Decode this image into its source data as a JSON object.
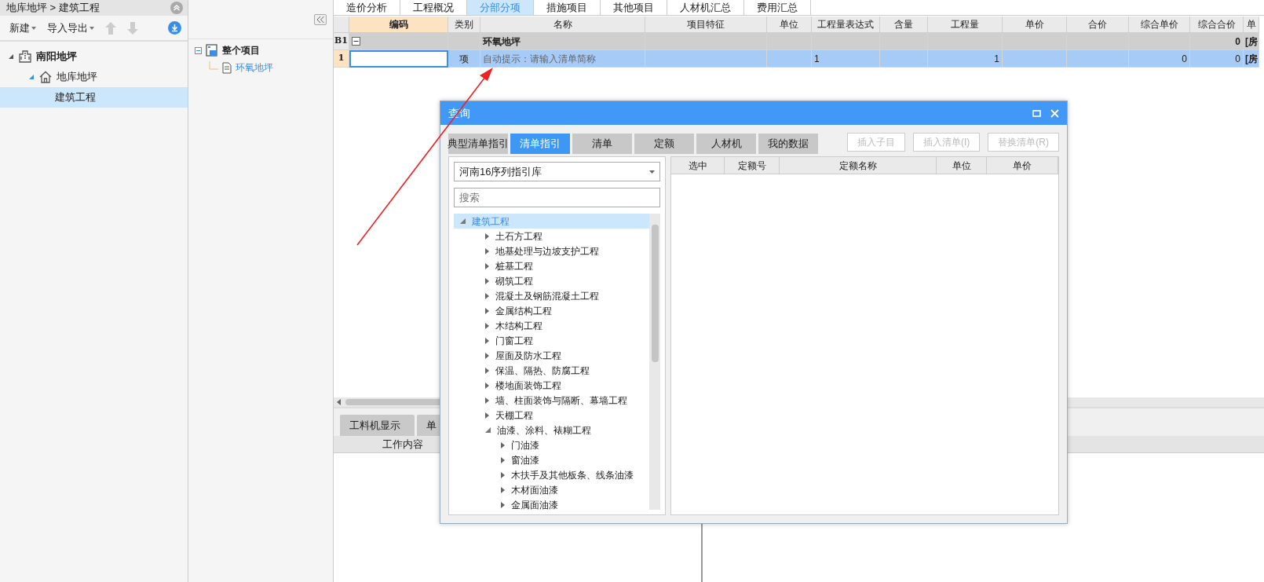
{
  "breadcrumb": "地库地坪 > 建筑工程",
  "toolbar": [
    {
      "label": "新建"
    },
    {
      "label": "导入导出"
    }
  ],
  "project_tree": [
    {
      "label": "南阳地坪",
      "kind": "project",
      "expanded": true,
      "selected": false,
      "children": [
        {
          "label": "地库地坪",
          "kind": "unit",
          "expanded": true,
          "selected": false,
          "children": [
            {
              "label": "建筑工程",
              "selected": true
            }
          ]
        }
      ]
    }
  ],
  "section_tree": [
    {
      "label": "整个项目",
      "kind": "root",
      "expanded": true,
      "selected": false,
      "children": [
        {
          "label": "环氧地坪",
          "kind": "section",
          "selected": true
        }
      ]
    }
  ],
  "tabs": [
    {
      "label": "造价分析",
      "selected": false
    },
    {
      "label": "工程概况",
      "selected": false
    },
    {
      "label": "分部分项",
      "selected": true
    },
    {
      "label": "措施项目",
      "selected": false
    },
    {
      "label": "其他项目",
      "selected": false
    },
    {
      "label": "人材机汇总",
      "selected": false
    },
    {
      "label": "费用汇总",
      "selected": false
    }
  ],
  "table": {
    "columns": [
      "编码",
      "类别",
      "名称",
      "项目特征",
      "单位",
      "工程量表达式",
      "含量",
      "工程量",
      "单价",
      "合价",
      "综合单价",
      "综合合价",
      "单"
    ],
    "rows": [
      {
        "row_header": "B1",
        "kind": "section",
        "expanded": true,
        "selected": false,
        "name": "环氧地坪",
        "composite_total_price": "0",
        "column_13": "[房"
      },
      {
        "row_header": "1",
        "kind": "item",
        "selected": true,
        "category": "项",
        "name_placeholder": "自动提示：请输入清单简称",
        "quantity_expression": "1",
        "quantity": "1",
        "composite_unit_price": "0",
        "composite_total_price": "0",
        "column_13": "[房"
      }
    ]
  },
  "bottom_tabs": [
    {
      "label": "工料机显示",
      "selected": false
    },
    {
      "label": "单",
      "selected": false
    }
  ],
  "bottom_header": "工作内容",
  "dialog": {
    "title": "查询",
    "tabs": [
      {
        "label": "典型清单指引",
        "selected": false
      },
      {
        "label": "清单指引",
        "selected": true
      },
      {
        "label": "清单",
        "selected": false
      },
      {
        "label": "定额",
        "selected": false
      },
      {
        "label": "人材机",
        "selected": false
      },
      {
        "label": "我的数据",
        "selected": false
      }
    ],
    "buttons": [
      {
        "label": "插入子目",
        "disabled": true
      },
      {
        "label": "插入清单(I)",
        "disabled": true
      },
      {
        "label": "替换清单(R)",
        "disabled": true
      }
    ],
    "library": {
      "value": "河南16序列指引库"
    },
    "search": {
      "placeholder": "搜索"
    },
    "tree": [
      {
        "label": "建筑工程",
        "expanded": true,
        "selected": true,
        "children": [
          {
            "label": "土石方工程",
            "expanded": false,
            "selected": false
          },
          {
            "label": "地基处理与边坡支护工程",
            "expanded": false,
            "selected": false
          },
          {
            "label": "桩基工程",
            "expanded": false,
            "selected": false
          },
          {
            "label": "砌筑工程",
            "expanded": false,
            "selected": false
          },
          {
            "label": "混凝土及钢筋混凝土工程",
            "expanded": false,
            "selected": false
          },
          {
            "label": "金属结构工程",
            "expanded": false,
            "selected": false
          },
          {
            "label": "木结构工程",
            "expanded": false,
            "selected": false
          },
          {
            "label": "门窗工程",
            "expanded": false,
            "selected": false
          },
          {
            "label": "屋面及防水工程",
            "expanded": false,
            "selected": false
          },
          {
            "label": "保温、隔热、防腐工程",
            "expanded": false,
            "selected": false
          },
          {
            "label": "楼地面装饰工程",
            "expanded": false,
            "selected": false
          },
          {
            "label": "墙、柱面装饰与隔断、幕墙工程",
            "expanded": false,
            "selected": false
          },
          {
            "label": "天棚工程",
            "expanded": false,
            "selected": false
          },
          {
            "label": "油漆、涂料、裱糊工程",
            "expanded": true,
            "selected": false,
            "children": [
              {
                "label": "门油漆",
                "expanded": false,
                "selected": false
              },
              {
                "label": "窗油漆",
                "expanded": false,
                "selected": false
              },
              {
                "label": "木扶手及其他板条、线条油漆",
                "expanded": false,
                "selected": false
              },
              {
                "label": "木材面油漆",
                "expanded": false,
                "selected": false
              },
              {
                "label": "金属面油漆",
                "expanded": false,
                "selected": false
              }
            ]
          }
        ]
      }
    ],
    "grid": {
      "columns": [
        "选中",
        "定额号",
        "定额名称",
        "单位",
        "单价"
      ]
    }
  }
}
